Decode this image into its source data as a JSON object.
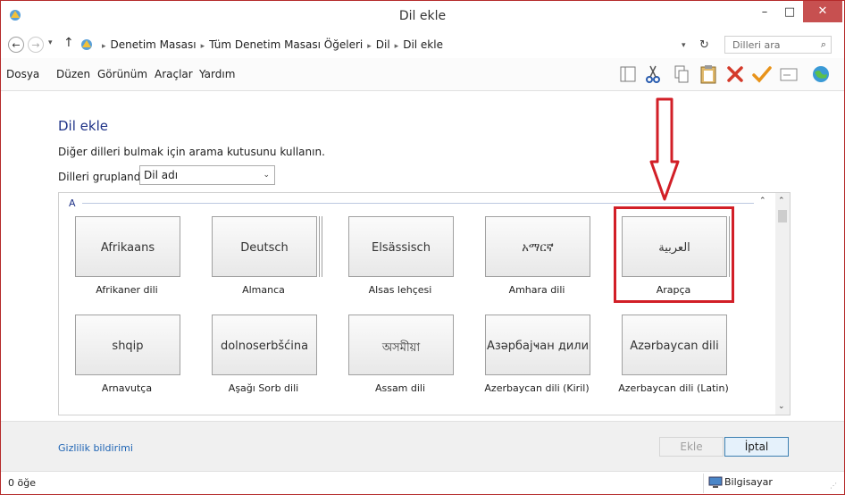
{
  "window": {
    "title": "Dil ekle",
    "minimize": "–",
    "maximize": "□",
    "close": "✕"
  },
  "address": {
    "back": "←",
    "forward": "→",
    "recent": "▾",
    "up": "↑",
    "crumbs": [
      "Denetim Masası",
      "Tüm Denetim Masası Öğeleri",
      "Dil",
      "Dil ekle"
    ],
    "separator": "▸",
    "dropdown": "▾",
    "refresh": "↻",
    "search_placeholder": "Dilleri ara",
    "search_icon": "⌕"
  },
  "menu": [
    "Dosya",
    "Düzen",
    "Görünüm",
    "Araçlar",
    "Yardım"
  ],
  "toolbar_icons": [
    "layout-icon",
    "cut-icon",
    "copy-icon",
    "paste-icon",
    "delete-icon",
    "check-icon",
    "properties-icon",
    "globe-icon"
  ],
  "page": {
    "heading": "Dil ekle",
    "hint": "Diğer dilleri bulmak için arama kutusunu kullanın.",
    "group_label": "Dilleri gruplandır:",
    "group_value": "Dil adı",
    "group_dropdown": "⌄"
  },
  "list": {
    "group_letter": "A",
    "collapse": "⌃",
    "scroll_up": "⌃",
    "scroll_down": "⌄",
    "tiles": [
      {
        "native": "Afrikaans",
        "caption": "Afrikaner dili",
        "stacked": false
      },
      {
        "native": "Deutsch",
        "caption": "Almanca",
        "stacked": true
      },
      {
        "native": "Elsässisch",
        "caption": "Alsas lehçesi",
        "stacked": false
      },
      {
        "native": "አማርኛ",
        "caption": "Amhara dili",
        "stacked": false
      },
      {
        "native": "العربية",
        "caption": "Arapça",
        "stacked": true
      },
      {
        "native": "shqip",
        "caption": "Arnavutça",
        "stacked": false
      },
      {
        "native": "dolnoserbšćina",
        "caption": "Aşağı Sorb dili",
        "stacked": false
      },
      {
        "native": "অসমীয়া",
        "caption": "Assam dili",
        "stacked": false
      },
      {
        "native": "Азәрбајҹан дили",
        "caption": "Azerbaycan dili (Kiril)",
        "stacked": false
      },
      {
        "native": "Azərbaycan dili",
        "caption": "Azerbaycan dili (Latin)",
        "stacked": false
      }
    ]
  },
  "footer": {
    "privacy": "Gizlilik bildirimi",
    "add": "Ekle",
    "cancel": "İptal"
  },
  "status": {
    "count": "0 öğe",
    "zone": "Bilgisayar",
    "grip": "⋰"
  },
  "colors": {
    "accent": "#1e3287",
    "highlight": "#d21f27",
    "link": "#1e64b4"
  }
}
